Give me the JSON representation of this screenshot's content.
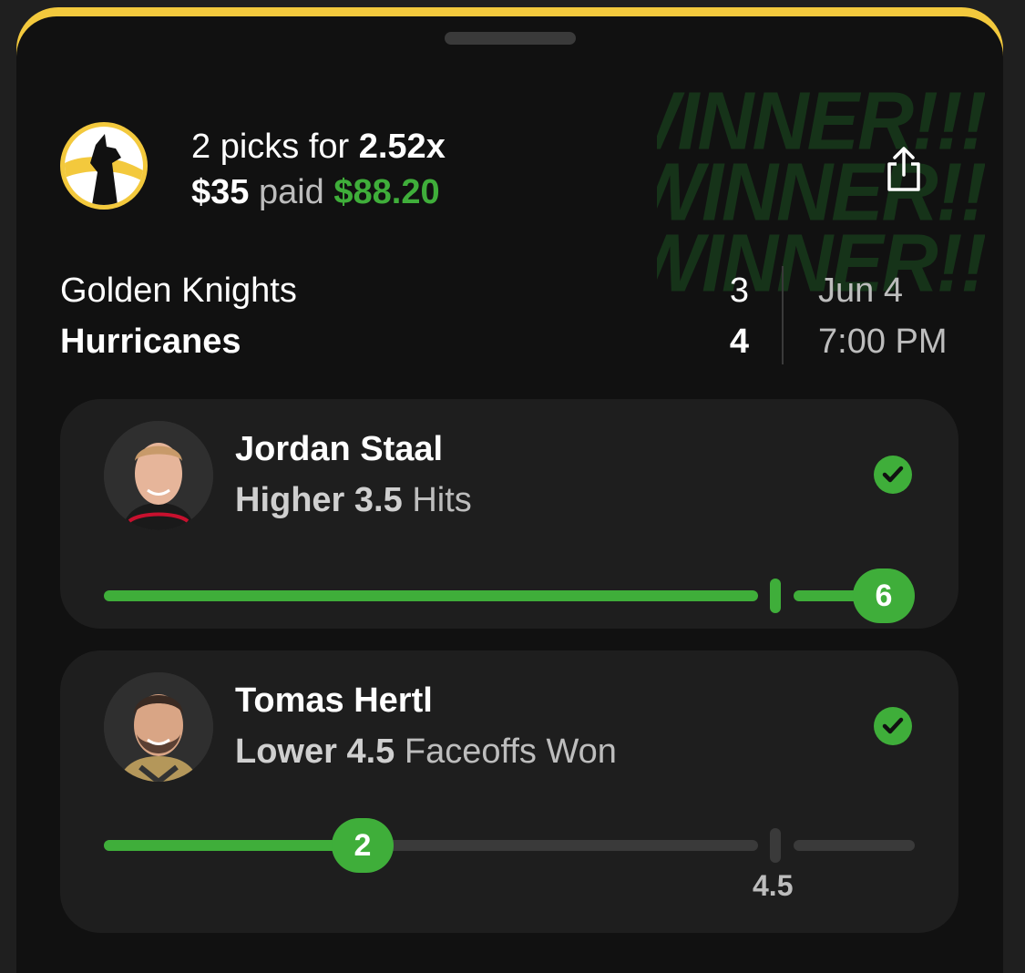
{
  "headline": {
    "picks_text": "2 picks for ",
    "multiplier": "2.52x",
    "stake": "$35",
    "paid_label": " paid ",
    "payout": "$88.20"
  },
  "background_text": [
    "WINNER!!!",
    "WINNER!!",
    "WINNER!!"
  ],
  "game": {
    "away_team": "Golden Knights",
    "home_team": "Hurricanes",
    "away_score": "3",
    "home_score": "4",
    "date": "Jun 4",
    "time": "7:00 PM"
  },
  "picks": [
    {
      "player": "Jordan Staal",
      "direction": "Higher",
      "line": "3.5",
      "stat": "Hits",
      "result": "6",
      "status": "won"
    },
    {
      "player": "Tomas Hertl",
      "direction": "Lower",
      "line": "4.5",
      "stat": "Faceoffs Won",
      "result": "2",
      "line_label": "4.5",
      "status": "won"
    }
  ],
  "colors": {
    "accent_green": "#3fae3a",
    "brand_yellow": "#f3c93d",
    "background": "#111111",
    "card": "#1e1e1e"
  },
  "icons": [
    "share-icon",
    "check-icon",
    "team-logo"
  ]
}
